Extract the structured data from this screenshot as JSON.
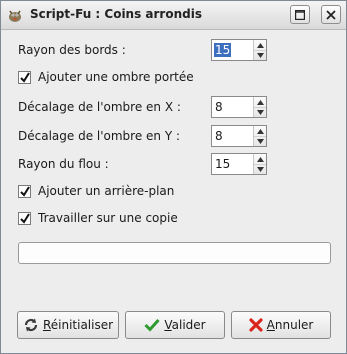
{
  "window": {
    "title": "Script-Fu : Coins arrondis"
  },
  "form": {
    "radius": {
      "label": "Rayon des bords :",
      "value": "15",
      "selected": true
    },
    "drop_shadow": {
      "label": "Ajouter une ombre portée",
      "checked": true
    },
    "shadow_x": {
      "label": "Décalage de l'ombre en X :",
      "value": "8"
    },
    "shadow_y": {
      "label": "Décalage de l'ombre en Y :",
      "value": "8"
    },
    "blur_radius": {
      "label": "Rayon du flou :",
      "value": "15"
    },
    "add_background": {
      "label": "Ajouter un arrière-plan",
      "checked": true
    },
    "work_on_copy": {
      "label": "Travailler sur une copie",
      "checked": true
    }
  },
  "progress": {
    "fraction": 0
  },
  "buttons": {
    "reset": {
      "label_rest": "éinitialiser",
      "mnemonic": "R"
    },
    "ok": {
      "label_rest": "alider",
      "mnemonic": "V"
    },
    "cancel": {
      "label_rest": "nnuler",
      "mnemonic": "A"
    }
  },
  "colors": {
    "selection": "#3d6fbf",
    "ok_check": "#2e9a2e",
    "cancel_x": "#d8261c"
  }
}
